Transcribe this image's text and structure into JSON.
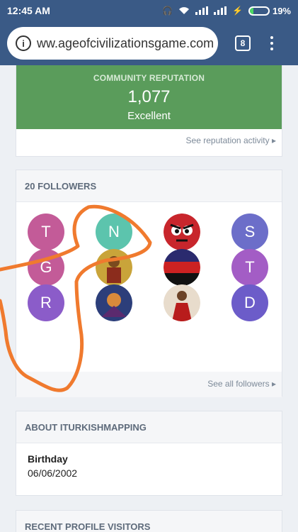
{
  "status_bar": {
    "time": "12:45 AM",
    "battery": "19%",
    "battery_level": 0.19
  },
  "browser": {
    "url": "ww.ageofcivilizationsgame.com",
    "tab_count": "8"
  },
  "reputation": {
    "label": "COMMUNITY REPUTATION",
    "value": "1,077",
    "rating": "Excellent",
    "link": "See reputation activity",
    "color": "#5a9c5b"
  },
  "followers": {
    "title": "20 FOLLOWERS",
    "link": "See all followers",
    "items": [
      {
        "letter": "T",
        "color": "#c35b98"
      },
      {
        "letter": "N",
        "color": "#5cc4ad"
      },
      {
        "letter": "",
        "image": "angry-countryball"
      },
      {
        "letter": "S",
        "color": "#6c6ec9"
      },
      {
        "letter": "G",
        "color": "#c35b98"
      },
      {
        "letter": "",
        "image": "byzantine-icon"
      },
      {
        "letter": "",
        "image": "tricolor-flag"
      },
      {
        "letter": "T",
        "color": "#a35dc5"
      },
      {
        "letter": "R",
        "color": "#8b5cc9"
      },
      {
        "letter": "",
        "image": "fantasy-art"
      },
      {
        "letter": "",
        "image": "red-robed-figure"
      },
      {
        "letter": "D",
        "color": "#6c5cc9"
      }
    ]
  },
  "about": {
    "title": "ABOUT ITURKISHMAPPING",
    "birthday_label": "Birthday",
    "birthday_value": "06/06/2002"
  },
  "visitors": {
    "title": "RECENT PROFILE VISITORS"
  },
  "annotation_color": "#f07a2e"
}
